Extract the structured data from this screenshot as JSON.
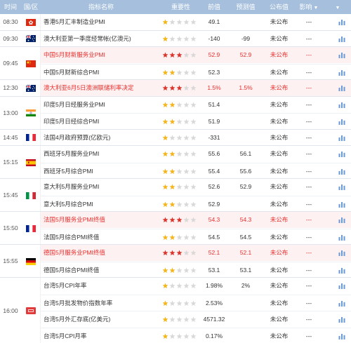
{
  "header": {
    "time": "时间",
    "region": "国/区",
    "name": "指标名称",
    "importance": "重要性",
    "previous": "前值",
    "forecast": "预测值",
    "actual": "公布值",
    "effect": "影响",
    "effect_caret": "▼",
    "extra_caret": "▼"
  },
  "colors": {
    "header_bg": "#a5bfdc",
    "highlight_text": "#e8302e",
    "highlight_bg": "#fdf1f1",
    "star_high": "#d9342b",
    "star_mid": "#f5b41a",
    "star_empty": "#d8d8d8",
    "chart_icon": "#6a9ad8"
  },
  "groups": [
    {
      "time": "08:30",
      "flags": [
        "hongkong"
      ],
      "rows": [
        {
          "name": "香港5月汇丰制造业PMI",
          "stars": 1,
          "prev": "49.1",
          "forecast": "",
          "actual": "未公布",
          "effect": "---",
          "highlight": false
        }
      ]
    },
    {
      "time": "09:30",
      "flags": [
        "australia"
      ],
      "rows": [
        {
          "name": "澳大利亚第一季度经常帐(亿澳元)",
          "stars": 1,
          "prev": "-140",
          "forecast": "-99",
          "actual": "未公布",
          "effect": "---",
          "highlight": false
        }
      ]
    },
    {
      "time": "09:45",
      "flags": [
        "china"
      ],
      "rows": [
        {
          "name": "中国5月财新服务业PMI",
          "stars": 3,
          "prev": "52.9",
          "forecast": "52.9",
          "actual": "未公布",
          "effect": "---",
          "highlight": true
        },
        {
          "name": "中国5月财新综合PMI",
          "stars": 2,
          "prev": "52.3",
          "forecast": "",
          "actual": "未公布",
          "effect": "---",
          "highlight": false
        }
      ]
    },
    {
      "time": "12:30",
      "flags": [
        "australia"
      ],
      "rows": [
        {
          "name": "澳大利亚6月5日澳洲联储利率决定",
          "stars": 3,
          "prev": "1.5%",
          "forecast": "1.5%",
          "actual": "未公布",
          "effect": "---",
          "highlight": true
        }
      ]
    },
    {
      "time": "13:00",
      "flags": [
        "india"
      ],
      "rows": [
        {
          "name": "印度5月日经服务业PMI",
          "stars": 2,
          "prev": "51.4",
          "forecast": "",
          "actual": "未公布",
          "effect": "---",
          "highlight": false
        },
        {
          "name": "印度5月日经综合PMI",
          "stars": 2,
          "prev": "51.9",
          "forecast": "",
          "actual": "未公布",
          "effect": "---",
          "highlight": false
        }
      ]
    },
    {
      "time": "14:45",
      "flags": [
        "france"
      ],
      "rows": [
        {
          "name": "法国4月政府预算(亿欧元)",
          "stars": 1,
          "prev": "-331",
          "forecast": "",
          "actual": "未公布",
          "effect": "---",
          "highlight": false
        }
      ]
    },
    {
      "time": "15:15",
      "flags": [
        "spain"
      ],
      "rows": [
        {
          "name": "西班牙5月服务业PMI",
          "stars": 2,
          "prev": "55.6",
          "forecast": "56.1",
          "actual": "未公布",
          "effect": "---",
          "highlight": false
        },
        {
          "name": "西班牙5月综合PMI",
          "stars": 2,
          "prev": "55.4",
          "forecast": "55.6",
          "actual": "未公布",
          "effect": "---",
          "highlight": false
        }
      ]
    },
    {
      "time": "15:45",
      "flags": [
        "italy"
      ],
      "rows": [
        {
          "name": "意大利5月服务业PMI",
          "stars": 2,
          "prev": "52.6",
          "forecast": "52.9",
          "actual": "未公布",
          "effect": "---",
          "highlight": false
        },
        {
          "name": "意大利5月综合PMI",
          "stars": 2,
          "prev": "52.9",
          "forecast": "",
          "actual": "未公布",
          "effect": "---",
          "highlight": false
        }
      ]
    },
    {
      "time": "15:50",
      "flags": [
        "france"
      ],
      "rows": [
        {
          "name": "法国5月服务业PMI终值",
          "stars": 3,
          "prev": "54.3",
          "forecast": "54.3",
          "actual": "未公布",
          "effect": "---",
          "highlight": true
        },
        {
          "name": "法国5月综合PMI终值",
          "stars": 2,
          "prev": "54.5",
          "forecast": "54.5",
          "actual": "未公布",
          "effect": "---",
          "highlight": false
        }
      ]
    },
    {
      "time": "15:55",
      "flags": [
        "germany"
      ],
      "rows": [
        {
          "name": "德国5月服务业PMI终值",
          "stars": 3,
          "prev": "52.1",
          "forecast": "52.1",
          "actual": "未公布",
          "effect": "---",
          "highlight": true
        },
        {
          "name": "德国5月综合PMI终值",
          "stars": 2,
          "prev": "53.1",
          "forecast": "53.1",
          "actual": "未公布",
          "effect": "---",
          "highlight": false
        }
      ]
    },
    {
      "time": "16:00",
      "flags": [
        "taiwan"
      ],
      "rows": [
        {
          "name": "台湾5月CPI年率",
          "stars": 1,
          "prev": "1.98%",
          "forecast": "2%",
          "actual": "未公布",
          "effect": "---",
          "highlight": false
        },
        {
          "name": "台湾5月批发物价指数年率",
          "stars": 1,
          "prev": "2.53%",
          "forecast": "",
          "actual": "未公布",
          "effect": "---",
          "highlight": false
        },
        {
          "name": "台湾5月外汇存底(亿美元)",
          "stars": 1,
          "prev": "4571.32",
          "forecast": "",
          "actual": "未公布",
          "effect": "---",
          "highlight": false
        },
        {
          "name": "台湾5月CPI月率",
          "stars": 1,
          "prev": "0.17%",
          "forecast": "",
          "actual": "未公布",
          "effect": "---",
          "highlight": false
        }
      ]
    }
  ]
}
